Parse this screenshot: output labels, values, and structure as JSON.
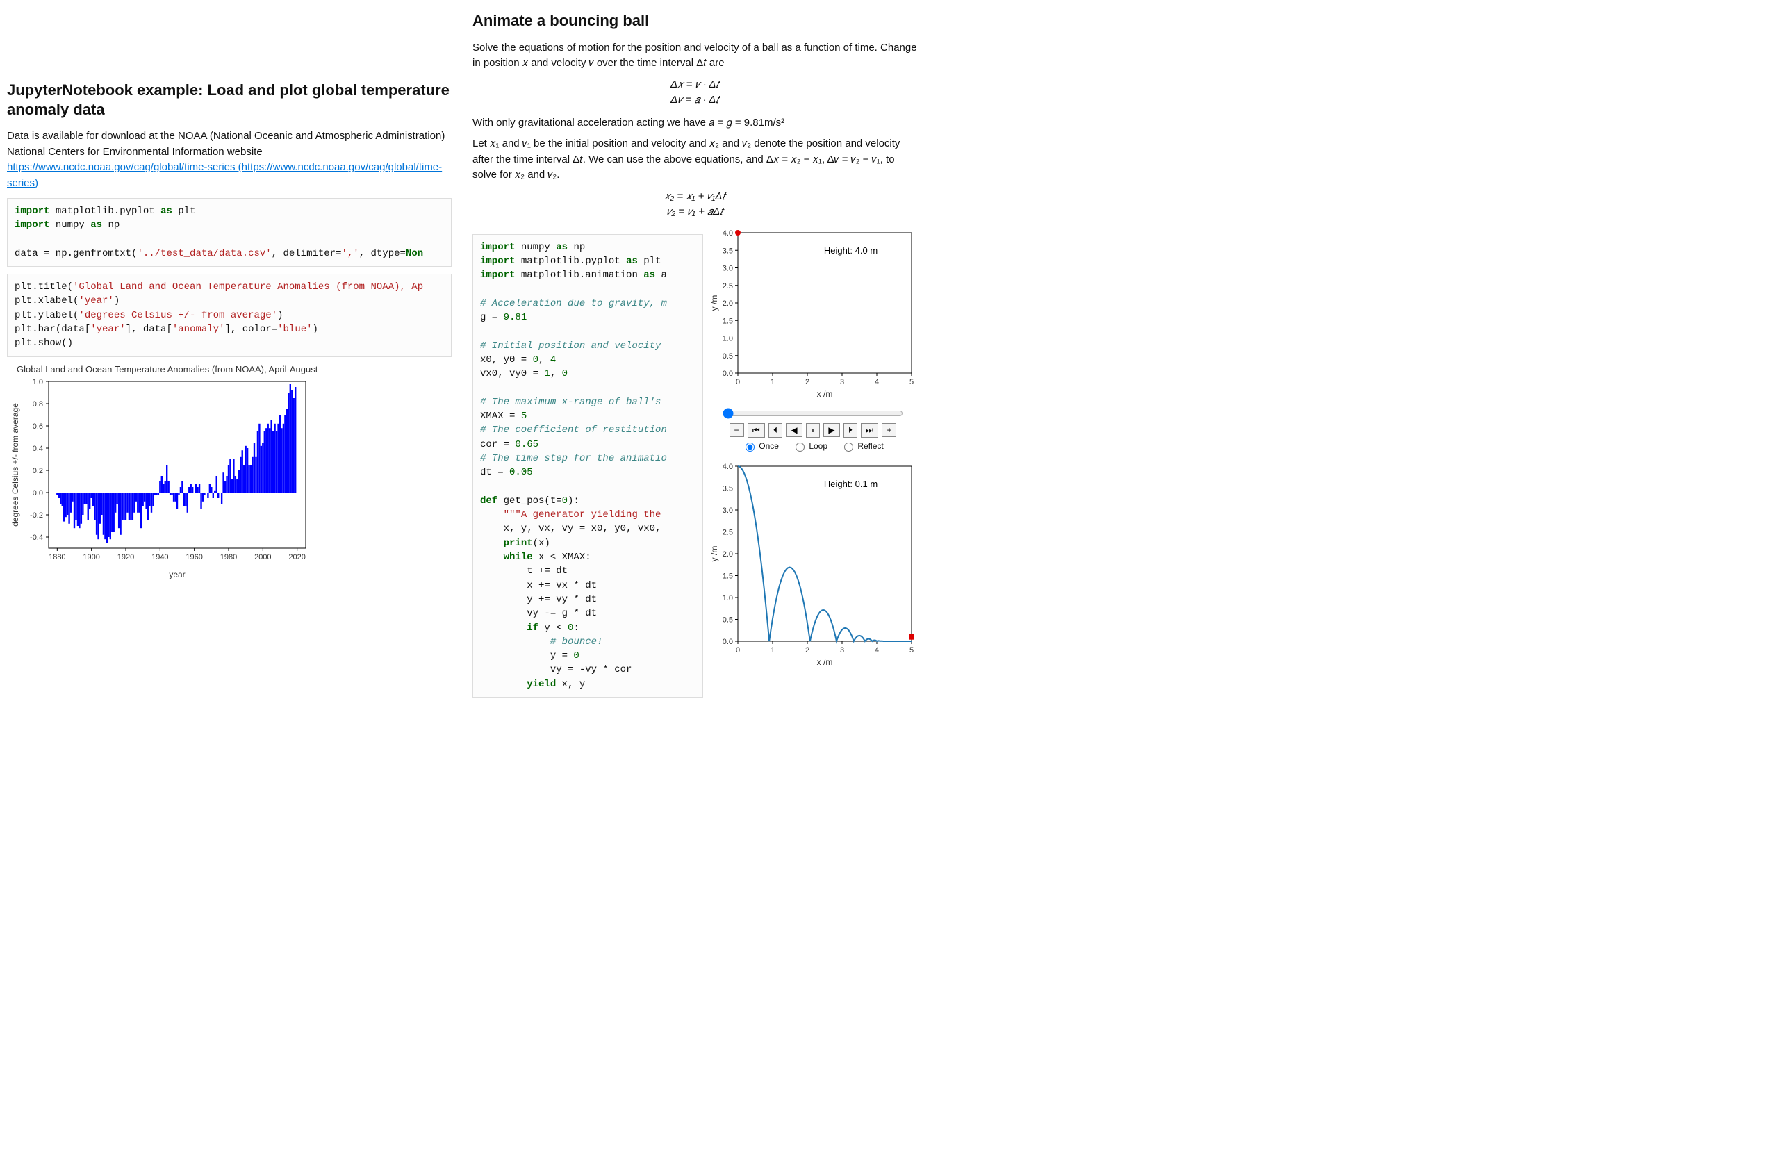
{
  "left": {
    "title": "JupyterNotebook example: Load and plot global temperature anomaly data",
    "intro1": "Data is available for download at the NOAA (National Oceanic and Atmospheric Administration) National Centers for Environmental Information website",
    "link_text": "https://www.ncdc.noaa.gov/cag/global/time-series (https://www.ncdc.noaa.gov/cag/global/time-series)",
    "code1": {
      "l1a": "import",
      "l1b": " matplotlib.pyplot ",
      "l1c": "as",
      "l1d": " plt",
      "l2a": "import",
      "l2b": " numpy ",
      "l2c": "as",
      "l2d": " np",
      "l3a": "data = np.genfromtxt(",
      "l3b": "'../test_data/data.csv'",
      "l3c": ", delimiter=",
      "l3d": "','",
      "l3e": ", dtype=",
      "l3f": "Non"
    },
    "code2": {
      "l1a": "plt.title(",
      "l1b": "'Global Land and Ocean Temperature Anomalies (from NOAA), Ap",
      "l2a": "plt.xlabel(",
      "l2b": "'year'",
      "l2c": ")",
      "l3a": "plt.ylabel(",
      "l3b": "'degrees Celsius +/- from average'",
      "l3c": ")",
      "l4a": "plt.bar(data[",
      "l4b": "'year'",
      "l4c": "], data[",
      "l4d": "'anomaly'",
      "l4e": "], color=",
      "l4f": "'blue'",
      "l4g": ")",
      "l5a": "plt.show()"
    },
    "chart_title": "Global Land and Ocean Temperature Anomalies (from NOAA), April-August",
    "chart_xlabel": "year",
    "chart_ylabel": "degrees Celsius +/- from average"
  },
  "right": {
    "title": "Animate a bouncing ball",
    "p1": "Solve the equations of motion for the position and velocity of a ball as a function of time. Change in position 𝑥 and velocity 𝑣 over the time interval Δ𝑡 are",
    "eq1": "Δ𝑥 = 𝑣 · Δ𝑡",
    "eq2": "Δ𝑣 = 𝑎 · Δ𝑡",
    "p2": "With only gravitational acceleration acting we have 𝑎 = 𝑔 = 9.81m/s²",
    "p3": "Let 𝑥₁ and 𝑣₁ be the initial position and velocity and 𝑥₂ and 𝑣₂ denote the position and velocity after the time interval Δ𝑡. We can use the above equations, and Δ𝑥 = 𝑥₂ − 𝑥₁, Δ𝑣 = 𝑣₂ − 𝑣₁, to solve for 𝑥₂ and 𝑣₂.",
    "eq3": "𝑥₂ = 𝑥₁ + 𝑣₁Δ𝑡",
    "eq4": "𝑣₂ = 𝑣₁ + 𝑎Δ𝑡",
    "code": {
      "l1a": "import",
      "l1b": " numpy ",
      "l1c": "as",
      "l1d": " np",
      "l2a": "import",
      "l2b": " matplotlib.pyplot ",
      "l2c": "as",
      "l2d": " plt",
      "l3a": "import",
      "l3b": " matplotlib.animation ",
      "l3c": "as",
      "l3d": " a",
      "c1": "# Acceleration due to gravity, m",
      "l5": "g = ",
      "l5n": "9.81",
      "c2": "# Initial position and velocity",
      "l7": "x0, y0 = ",
      "l7n": "0",
      "l7s": ", ",
      "l7n2": "4",
      "l8": "vx0, vy0 = ",
      "l8n": "1",
      "l8s": ", ",
      "l8n2": "0",
      "c3": "# The maximum x-range of ball's",
      "l10": "XMAX = ",
      "l10n": "5",
      "c4": "# The coefficient of restitution",
      "l12": "cor = ",
      "l12n": "0.65",
      "c5": "# The time step for the animatio",
      "l14": "dt = ",
      "l14n": "0.05",
      "l16a": "def",
      "l16b": " get_pos(t=",
      "l16n": "0",
      "l16c": "):",
      "l17": "    ",
      "l17s": "\"\"\"A generator yielding the ",
      "l18": "    x, y, vx, vy = x0, y0, vx0,",
      "l19a": "    ",
      "l19b": "print",
      "l19c": "(x)",
      "l20a": "    ",
      "l20b": "while",
      "l20c": " x < XMAX:",
      "l21": "        t += dt",
      "l22": "        x += vx * dt",
      "l23": "        y += vy * dt",
      "l24": "        vy -= g * dt",
      "l25a": "        ",
      "l25b": "if",
      "l25c": " y < ",
      "l25n": "0",
      "l25d": ":",
      "l26": "            ",
      "l26c": "# bounce!",
      "l27": "            y = ",
      "l27n": "0",
      "l28": "            vy = -vy * cor",
      "l29a": "        ",
      "l29b": "yield",
      "l29c": " x, y"
    },
    "plot_top": {
      "height_label": "Height: 4.0 m",
      "xlabel": "x /m",
      "ylabel": "y /m"
    },
    "plot_bot": {
      "height_label": "Height: 0.1 m",
      "xlabel": "x /m",
      "ylabel": "y /m"
    },
    "controls": {
      "minus": "−",
      "rew": "⏮",
      "stepb": "⏴",
      "playb": "◀",
      "pause": "⏸",
      "playf": "▶",
      "stepf": "⏵",
      "fwd": "⏭",
      "plus": "+",
      "once": "Once",
      "loop": "Loop",
      "reflect": "Reflect"
    }
  },
  "chart_data": [
    {
      "type": "bar",
      "title": "Global Land and Ocean Temperature Anomalies (from NOAA), April-August",
      "xlabel": "year",
      "ylabel": "degrees Celsius +/- from average",
      "xlim": [
        1875,
        2025
      ],
      "ylim": [
        -0.5,
        1.0
      ],
      "xticks": [
        1880,
        1900,
        1920,
        1940,
        1960,
        1980,
        2000,
        2020
      ],
      "yticks": [
        -0.4,
        -0.2,
        0.0,
        0.2,
        0.4,
        0.6,
        0.8,
        1.0
      ],
      "categories_start": 1880,
      "values": [
        -0.02,
        -0.05,
        -0.1,
        -0.12,
        -0.26,
        -0.22,
        -0.2,
        -0.28,
        -0.18,
        -0.08,
        -0.32,
        -0.25,
        -0.3,
        -0.32,
        -0.28,
        -0.2,
        -0.1,
        -0.1,
        -0.25,
        -0.15,
        -0.05,
        -0.12,
        -0.25,
        -0.38,
        -0.42,
        -0.28,
        -0.2,
        -0.38,
        -0.42,
        -0.45,
        -0.4,
        -0.42,
        -0.35,
        -0.35,
        -0.18,
        -0.1,
        -0.32,
        -0.38,
        -0.25,
        -0.25,
        -0.25,
        -0.18,
        -0.25,
        -0.25,
        -0.25,
        -0.18,
        -0.08,
        -0.18,
        -0.18,
        -0.32,
        -0.12,
        -0.08,
        -0.15,
        -0.25,
        -0.12,
        -0.18,
        -0.12,
        -0.02,
        -0.02,
        -0.02,
        0.1,
        0.15,
        0.08,
        0.1,
        0.25,
        0.1,
        -0.02,
        -0.02,
        -0.08,
        -0.08,
        -0.15,
        -0.02,
        0.05,
        0.1,
        -0.12,
        -0.12,
        -0.18,
        0.05,
        0.08,
        0.05,
        0.0,
        0.08,
        0.05,
        0.08,
        -0.15,
        -0.08,
        -0.02,
        0.0,
        -0.05,
        0.08,
        0.05,
        -0.05,
        0.02,
        0.15,
        -0.05,
        0.0,
        -0.1,
        0.18,
        0.1,
        0.15,
        0.25,
        0.3,
        0.12,
        0.3,
        0.15,
        0.12,
        0.2,
        0.32,
        0.38,
        0.25,
        0.42,
        0.4,
        0.25,
        0.25,
        0.32,
        0.45,
        0.32,
        0.55,
        0.62,
        0.42,
        0.45,
        0.55,
        0.58,
        0.62,
        0.58,
        0.65,
        0.55,
        0.62,
        0.55,
        0.62,
        0.7,
        0.58,
        0.62,
        0.7,
        0.75,
        0.9,
        0.98,
        0.92,
        0.85,
        0.95
      ]
    },
    {
      "type": "scatter",
      "title": "Height: 4.0 m",
      "xlabel": "x /m",
      "ylabel": "y /m",
      "xlim": [
        0,
        5
      ],
      "ylim": [
        0,
        4
      ],
      "xticks": [
        0,
        1,
        2,
        3,
        4,
        5
      ],
      "yticks": [
        0.0,
        0.5,
        1.0,
        1.5,
        2.0,
        2.5,
        3.0,
        3.5,
        4.0
      ],
      "point": {
        "x": 0,
        "y": 4
      }
    },
    {
      "type": "line",
      "title": "Height: 0.1 m",
      "xlabel": "x /m",
      "ylabel": "y /m",
      "xlim": [
        0,
        5
      ],
      "ylim": [
        0,
        4
      ],
      "xticks": [
        0,
        1,
        2,
        3,
        4,
        5
      ],
      "yticks": [
        0.0,
        0.5,
        1.0,
        1.5,
        2.0,
        2.5,
        3.0,
        3.5,
        4.0
      ],
      "bounces_x": [
        0,
        0.903,
        2.077,
        2.84,
        3.336,
        3.658,
        3.868,
        4.004,
        4.092,
        4.15,
        4.188,
        4.212,
        4.228,
        4.238
      ],
      "peak_heights": [
        4.0,
        1.69,
        0.714,
        0.302,
        0.128,
        0.054,
        0.023,
        0.01,
        0.004,
        0.002,
        0.001,
        0.0,
        0.0
      ],
      "end_point": {
        "x": 5.0,
        "y": 0.1
      }
    }
  ]
}
